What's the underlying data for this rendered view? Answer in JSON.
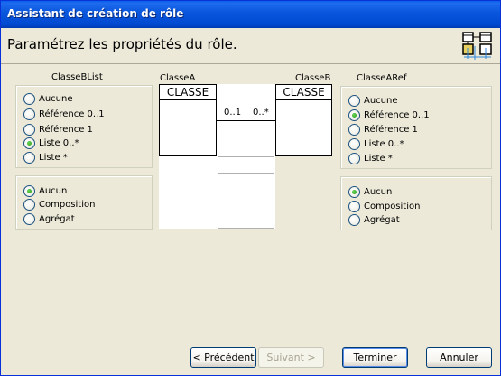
{
  "window": {
    "title": "Assistant de création de rôle"
  },
  "header": {
    "title": "Paramétrez les propriétés du rôle.",
    "icon": "class-diagram-icon"
  },
  "left": {
    "label": "ClasseBList",
    "multiplicity": [
      {
        "label": "Aucune",
        "selected": false
      },
      {
        "label": "Référence 0..1",
        "selected": false
      },
      {
        "label": "Référence 1",
        "selected": false
      },
      {
        "label": "Liste 0..*",
        "selected": true
      },
      {
        "label": "Liste *",
        "selected": false
      }
    ],
    "aggregation": [
      {
        "label": "Aucun",
        "selected": true
      },
      {
        "label": "Composition",
        "selected": false
      },
      {
        "label": "Agrégat",
        "selected": false
      }
    ]
  },
  "right": {
    "label": "ClasseARef",
    "multiplicity": [
      {
        "label": "Aucune",
        "selected": false
      },
      {
        "label": "Référence 0..1",
        "selected": true
      },
      {
        "label": "Référence 1",
        "selected": false
      },
      {
        "label": "Liste 0..*",
        "selected": false
      },
      {
        "label": "Liste *",
        "selected": false
      }
    ],
    "aggregation": [
      {
        "label": "Aucun",
        "selected": true
      },
      {
        "label": "Composition",
        "selected": false
      },
      {
        "label": "Agrégat",
        "selected": false
      }
    ]
  },
  "diagram": {
    "class_a_label": "ClasseA",
    "class_b_label": "ClasseB",
    "class_a_name": "CLASSE",
    "class_b_name": "CLASSE",
    "mult_left": "0..1",
    "mult_right": "0..*"
  },
  "buttons": {
    "previous": "< Précédent",
    "next": "Suivant >",
    "finish": "Terminer",
    "cancel": "Annuler"
  }
}
